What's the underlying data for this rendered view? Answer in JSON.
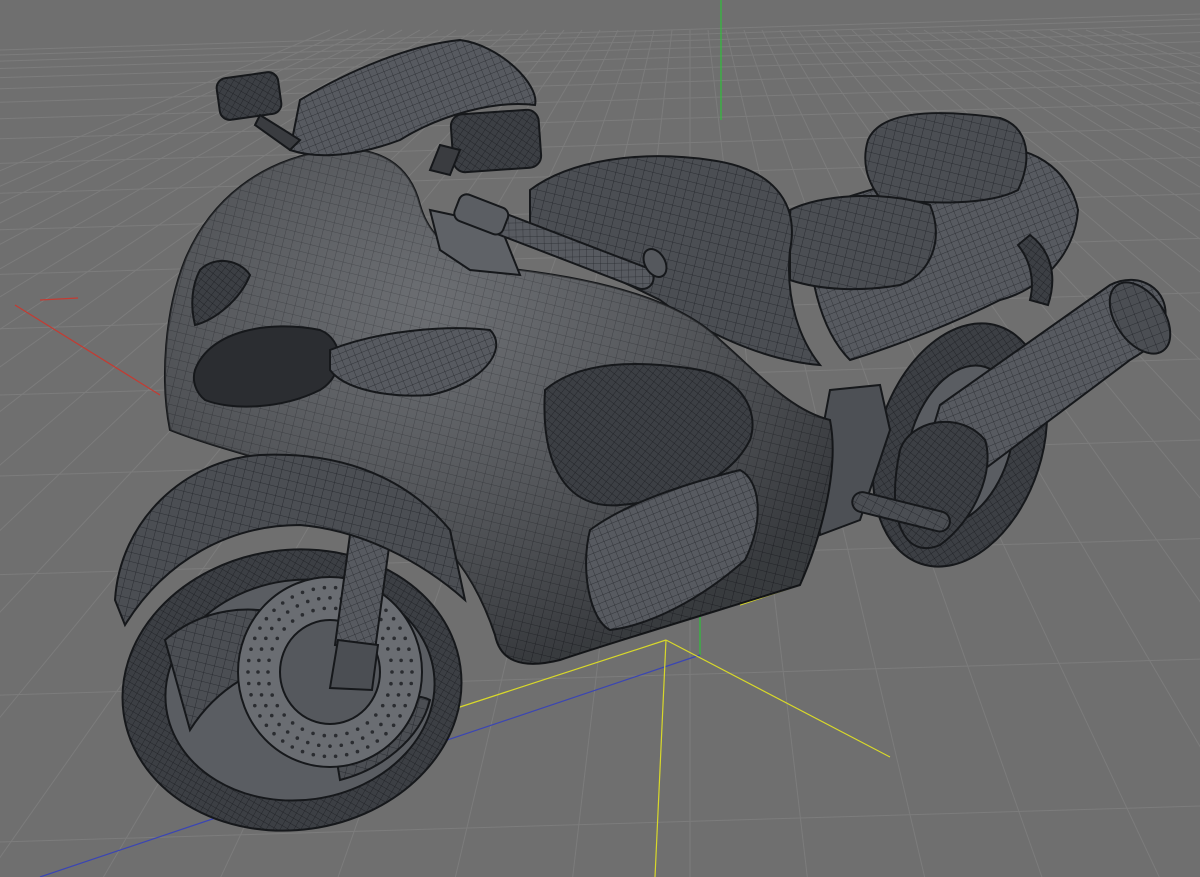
{
  "viewport": {
    "view": "perspective",
    "object": "motorcycle",
    "display_mode": "wireframe-on-shaded",
    "grid": true,
    "world_axes": true
  },
  "colors": {
    "background": "#6f6f6f",
    "grid_line": "#7c7c7c",
    "model_shade": "#4a4d52",
    "model_shade_dark": "#2c2e31",
    "wire": "#1d1f22",
    "axis_x": "#c43b32",
    "axis_y": "#2fbf3a",
    "axis_z": "#3a45b4",
    "axis_selected": "#d8d82a"
  }
}
